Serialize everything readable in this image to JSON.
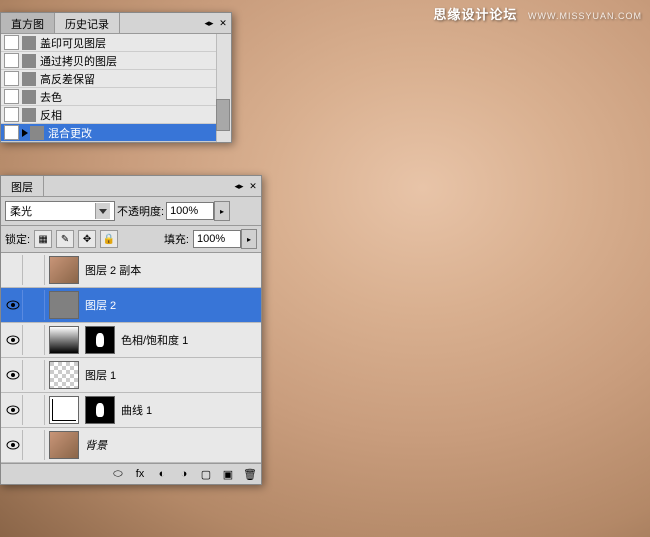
{
  "watermark": {
    "text": "思缘设计论坛",
    "url": "WWW.MISSYUAN.COM"
  },
  "history": {
    "tabs": {
      "t1": "直方图",
      "t2": "历史记录"
    },
    "items": [
      {
        "label": "盖印可见图层",
        "selected": false
      },
      {
        "label": "通过拷贝的图层",
        "selected": false
      },
      {
        "label": "高反差保留",
        "selected": false
      },
      {
        "label": "去色",
        "selected": false
      },
      {
        "label": "反相",
        "selected": false
      },
      {
        "label": "混合更改",
        "selected": true
      }
    ]
  },
  "layers": {
    "tab": "图层",
    "blend_mode": "柔光",
    "opacity_label": "不透明度:",
    "opacity_value": "100%",
    "lock_label": "锁定:",
    "fill_label": "填充:",
    "fill_value": "100%",
    "items": [
      {
        "name": "图层 2 副本",
        "visible": false,
        "thumb": "face",
        "selected": false
      },
      {
        "name": "图层 2",
        "visible": true,
        "thumb": "gray",
        "selected": true
      },
      {
        "name": "色相/饱和度 1",
        "visible": true,
        "thumb": "grad",
        "mask": true,
        "selected": false
      },
      {
        "name": "图层 1",
        "visible": true,
        "thumb": "trans",
        "selected": false
      },
      {
        "name": "曲线 1",
        "visible": true,
        "thumb": "curve",
        "mask": true,
        "selected": false
      },
      {
        "name": "背景",
        "visible": true,
        "thumb": "face",
        "italic": true,
        "selected": false
      }
    ]
  }
}
